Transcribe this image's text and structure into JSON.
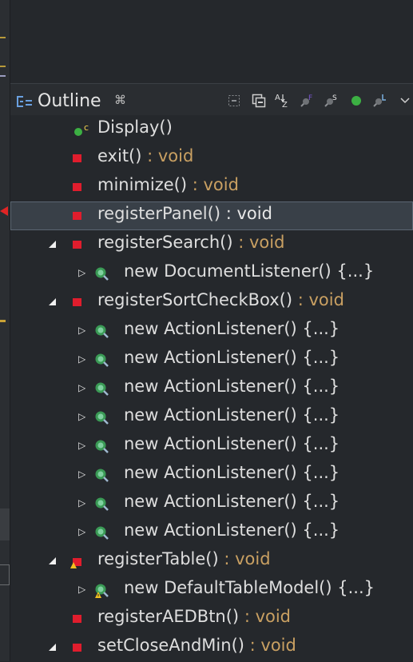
{
  "outline_view": {
    "title": "Outline",
    "close_label": "⌘"
  },
  "toolbar": [
    "collapse-all",
    "link-with-editor",
    "sort-alphabetically",
    "hide-fields",
    "hide-static",
    "hide-non-public",
    "hide-local-types",
    "view-menu"
  ],
  "tree": [
    {
      "name": "Display()",
      "ret": "",
      "kind": "constructor",
      "indent": 0,
      "expander": "none"
    },
    {
      "name": "exit()",
      "ret": " : void",
      "kind": "private-method",
      "indent": 0,
      "expander": "none"
    },
    {
      "name": "minimize()",
      "ret": " : void",
      "kind": "private-method",
      "indent": 0,
      "expander": "none"
    },
    {
      "name": "registerPanel()",
      "ret": " : void",
      "kind": "private-method",
      "indent": 0,
      "expander": "none",
      "selected": true
    },
    {
      "name": "registerSearch()",
      "ret": " : void",
      "kind": "private-method",
      "indent": 0,
      "expander": "open"
    },
    {
      "name": "new DocumentListener() {...}",
      "ret": "",
      "kind": "anonymous-class",
      "indent": 1,
      "expander": "closed"
    },
    {
      "name": "registerSortCheckBox()",
      "ret": " : void",
      "kind": "private-method",
      "indent": 0,
      "expander": "open"
    },
    {
      "name": "new ActionListener() {...}",
      "ret": "",
      "kind": "anonymous-class",
      "indent": 1,
      "expander": "closed"
    },
    {
      "name": "new ActionListener() {...}",
      "ret": "",
      "kind": "anonymous-class",
      "indent": 1,
      "expander": "closed"
    },
    {
      "name": "new ActionListener() {...}",
      "ret": "",
      "kind": "anonymous-class",
      "indent": 1,
      "expander": "closed"
    },
    {
      "name": "new ActionListener() {...}",
      "ret": "",
      "kind": "anonymous-class",
      "indent": 1,
      "expander": "closed"
    },
    {
      "name": "new ActionListener() {...}",
      "ret": "",
      "kind": "anonymous-class",
      "indent": 1,
      "expander": "closed"
    },
    {
      "name": "new ActionListener() {...}",
      "ret": "",
      "kind": "anonymous-class",
      "indent": 1,
      "expander": "closed"
    },
    {
      "name": "new ActionListener() {...}",
      "ret": "",
      "kind": "anonymous-class",
      "indent": 1,
      "expander": "closed"
    },
    {
      "name": "new ActionListener() {...}",
      "ret": "",
      "kind": "anonymous-class",
      "indent": 1,
      "expander": "closed"
    },
    {
      "name": "registerTable()",
      "ret": " : void",
      "kind": "private-method-warning",
      "indent": 0,
      "expander": "open"
    },
    {
      "name": "new DefaultTableModel() {...}",
      "ret": "",
      "kind": "anonymous-class-warning",
      "indent": 1,
      "expander": "closed"
    },
    {
      "name": "registerAEDBtn()",
      "ret": " : void",
      "kind": "private-method",
      "indent": 0,
      "expander": "none"
    },
    {
      "name": "setCloseAndMin()",
      "ret": " : void",
      "kind": "private-method",
      "indent": 0,
      "expander": "open"
    }
  ],
  "colors": {
    "private": "#e01d2d",
    "return_type": "#c9a062",
    "public": "#3cb043",
    "selection": "#394048"
  }
}
